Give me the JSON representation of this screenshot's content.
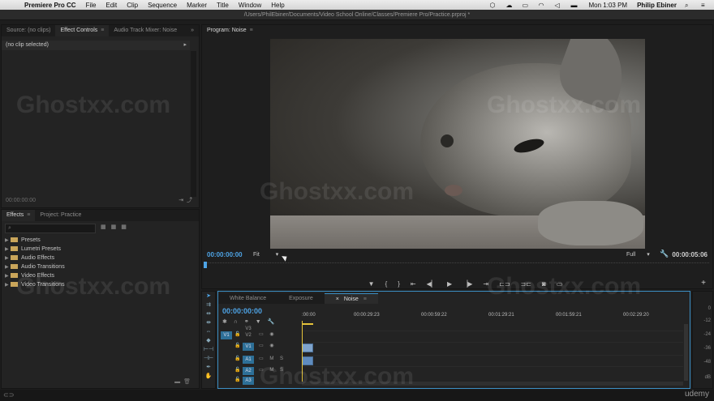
{
  "menubar": {
    "app_name": "Premiere Pro CC",
    "items": [
      "File",
      "Edit",
      "Clip",
      "Sequence",
      "Marker",
      "Title",
      "Window",
      "Help"
    ],
    "clock": "Mon 1:03 PM",
    "user": "Philip Ebiner"
  },
  "title_path": "/Users/PhilEbiner/Documents/Video School Online/Classes/Premiere Pro/Practice.prproj *",
  "effect_controls": {
    "tabs": [
      "Source: (no clips)",
      "Effect Controls",
      "Audio Track Mixer: Noise"
    ],
    "no_clip": "(no clip selected)",
    "time": "00:00:00:00",
    "play_glyph": "▸"
  },
  "effects_panel": {
    "tabs": [
      "Effects",
      "Project: Practice"
    ],
    "search_placeholder": "",
    "items": [
      "Presets",
      "Lumetri Presets",
      "Audio Effects",
      "Audio Transitions",
      "Video Effects",
      "Video Transitions"
    ]
  },
  "program_monitor": {
    "title": "Program: Noise",
    "time_left": "00:00:00:00",
    "fit": "Fit",
    "full": "Full",
    "time_right": "00:00:05:06"
  },
  "timeline": {
    "tabs": [
      "White Balance",
      "Exposure",
      "Noise"
    ],
    "active_tab": "Noise",
    "timecode": "00:00:00:00",
    "ruler": [
      ":00:00",
      "00:00:29:23",
      "00:00:59:22",
      "00:01:29:21",
      "00:01:59:21",
      "00:02:29:20"
    ],
    "tracks": [
      {
        "src": "",
        "name": "V3"
      },
      {
        "src": "V1",
        "name": "V2"
      },
      {
        "src": "",
        "name": "V1"
      },
      {
        "src": "",
        "name": "A1",
        "m": "M",
        "s": "S"
      },
      {
        "src": "",
        "name": "A2",
        "m": "M",
        "s": "S"
      },
      {
        "src": "",
        "name": "A3"
      }
    ]
  },
  "meter": {
    "db_labels": [
      "0",
      "-12",
      "-24",
      "-36",
      "-48",
      "dB"
    ]
  },
  "watermark": "Ghostxx.com",
  "brand": "udemy",
  "colors": {
    "accent": "#4ea4e6",
    "playhead": "#e5c33a",
    "clip": "#7fa4cc",
    "track_target": "#2d6f97",
    "folder": "#c9a55a"
  }
}
